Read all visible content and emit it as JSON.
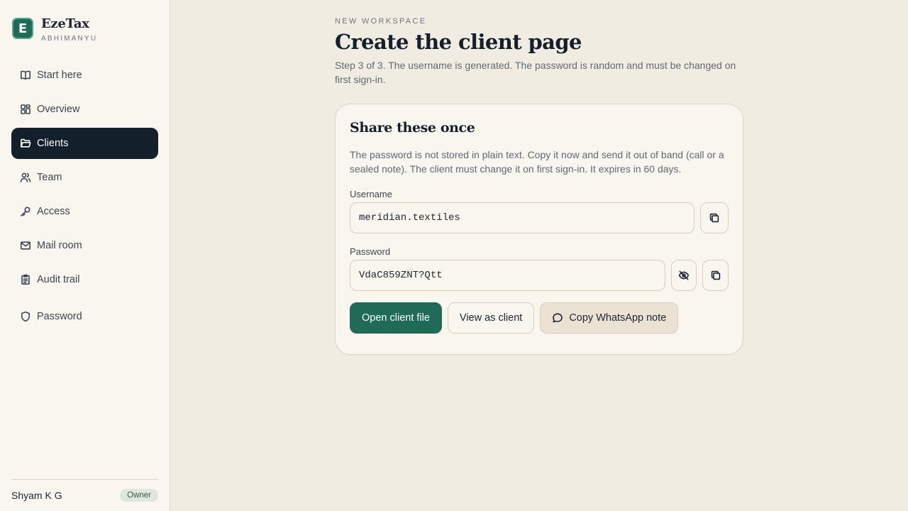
{
  "brand": {
    "name": "EzeTax",
    "workspace": "ABHIMANYU",
    "logo_letter": "E",
    "logo_color": "#1f6b57"
  },
  "sidebar": {
    "items": [
      {
        "label": "Start here",
        "icon": "book-icon"
      },
      {
        "label": "Overview",
        "icon": "dashboard-icon"
      },
      {
        "label": "Clients",
        "icon": "folder-icon",
        "active": true
      },
      {
        "label": "Team",
        "icon": "users-icon"
      },
      {
        "label": "Access",
        "icon": "key-icon"
      },
      {
        "label": "Mail room",
        "icon": "mail-icon"
      },
      {
        "label": "Audit trail",
        "icon": "clipboard-icon"
      },
      {
        "label": "Password",
        "icon": "shield-icon"
      }
    ],
    "user": {
      "name": "Shyam K G",
      "role": "Owner"
    }
  },
  "main": {
    "eyebrow": "NEW WORKSPACE",
    "title": "Create the client page",
    "description": "Step 3 of 3. The username is generated. The password is random and must be changed on first sign-in."
  },
  "card": {
    "title": "Share these once",
    "description": "The password is not stored in plain text. Copy it now and send it out of band (call or a sealed note). The client must change it on first sign-in. It expires in 60 days.",
    "username_label": "Username",
    "username_value": "meridian.textiles",
    "password_label": "Password",
    "password_value": "VdaC859ZNT?Qtt"
  },
  "actions": {
    "open_file": "Open client file",
    "view_as_client": "View as client",
    "copy_whatsapp": "Copy WhatsApp note"
  },
  "colors": {
    "accent": "#1f6b57",
    "active_nav": "#13202b",
    "background": "#f1ece2",
    "sidebar": "#f9f5ef"
  }
}
